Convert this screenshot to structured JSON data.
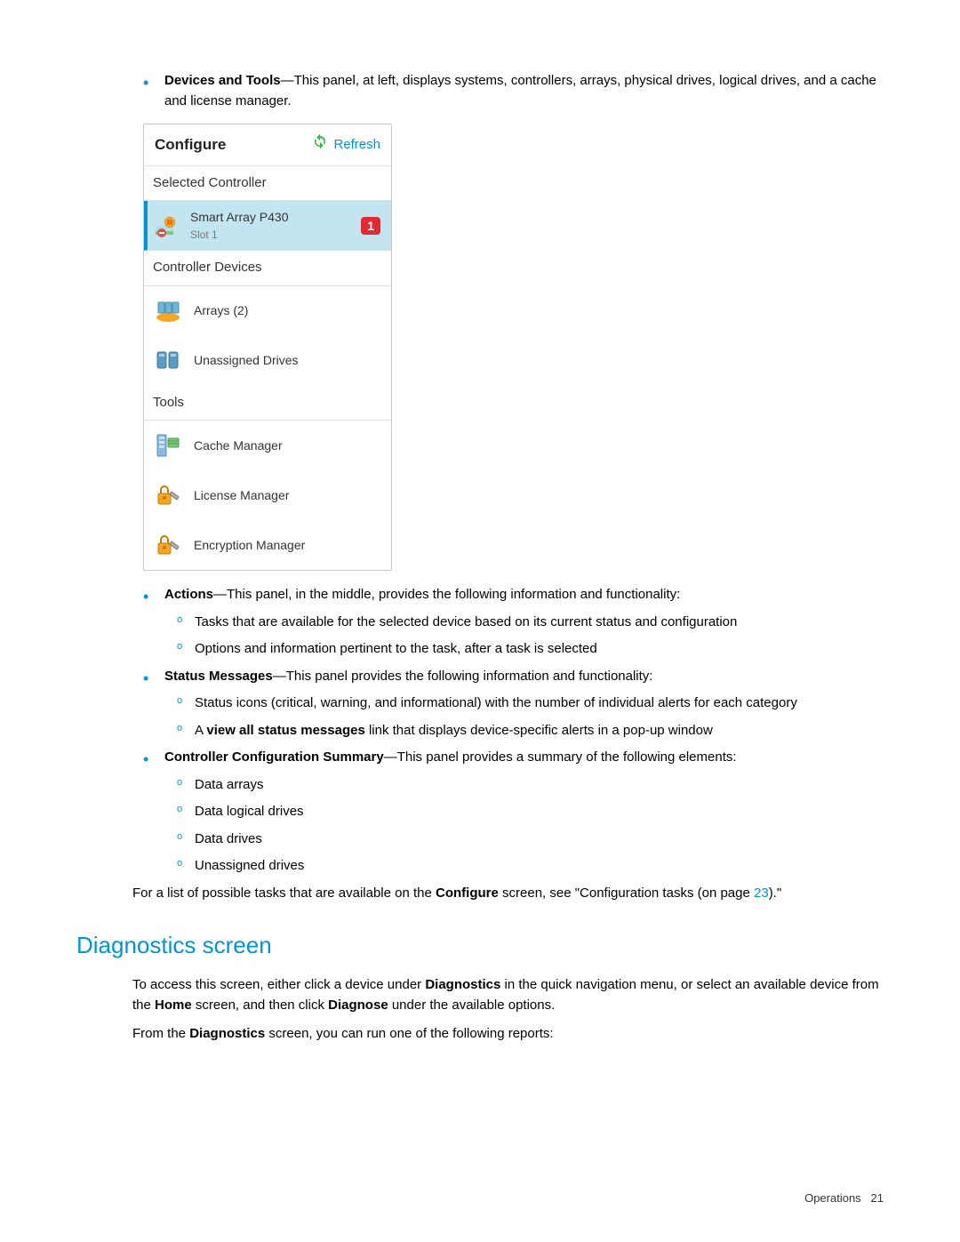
{
  "bullets": {
    "devices_tools": {
      "heading": "Devices and Tools",
      "text": "—This panel, at left, displays systems, controllers, arrays, physical drives, logical drives, and a cache and license manager."
    },
    "actions": {
      "heading": "Actions",
      "text": "—This panel, in the middle, provides the following information and functionality:",
      "subs": [
        "Tasks that are available for the selected device based on its current status and configuration",
        "Options and information pertinent to the task, after a task is selected"
      ]
    },
    "status_messages": {
      "heading": "Status Messages",
      "text": "—This panel provides the following information and functionality:",
      "sub1": "Status icons (critical, warning, and informational) with the number of individual alerts for each category",
      "sub2_pre": "A ",
      "sub2_bold": "view all status messages",
      "sub2_post": " link that displays device-specific alerts in a pop-up window"
    },
    "ccs": {
      "heading": "Controller Configuration Summary",
      "text": "—This panel provides a summary of the following elements:",
      "subs": [
        "Data arrays",
        "Data logical drives",
        "Data drives",
        "Unassigned drives"
      ]
    }
  },
  "closing_para": {
    "pre": "For a list of possible tasks that are available on the ",
    "bold1": "Configure",
    "mid": " screen, see \"Configuration tasks (on page ",
    "link": "23",
    "post": ").\""
  },
  "panel": {
    "title": "Configure",
    "refresh": "Refresh",
    "selected_controller_label": "Selected Controller",
    "controller": {
      "name": "Smart Array P430",
      "slot": "Slot 1",
      "badge": "1"
    },
    "controller_devices_label": "Controller Devices",
    "devices": [
      {
        "label": "Arrays (2)",
        "icon": "arrays-icon"
      },
      {
        "label": "Unassigned Drives",
        "icon": "drives-icon"
      }
    ],
    "tools_label": "Tools",
    "tools": [
      {
        "label": "Cache Manager",
        "icon": "cache-icon"
      },
      {
        "label": "License Manager",
        "icon": "lock-icon"
      },
      {
        "label": "Encryption Manager",
        "icon": "lock-icon"
      }
    ]
  },
  "diagnostics": {
    "heading": "Diagnostics screen",
    "p1_pre": "To access this screen, either click a device under ",
    "p1_b1": "Diagnostics",
    "p1_mid1": " in the quick navigation menu, or select an available device from the ",
    "p1_b2": "Home",
    "p1_mid2": " screen, and then click ",
    "p1_b3": "Diagnose",
    "p1_post": " under the available options.",
    "p2_pre": "From the ",
    "p2_b1": "Diagnostics",
    "p2_post": " screen, you can run one of the following reports:"
  },
  "footer": {
    "section": "Operations",
    "page": "21"
  }
}
